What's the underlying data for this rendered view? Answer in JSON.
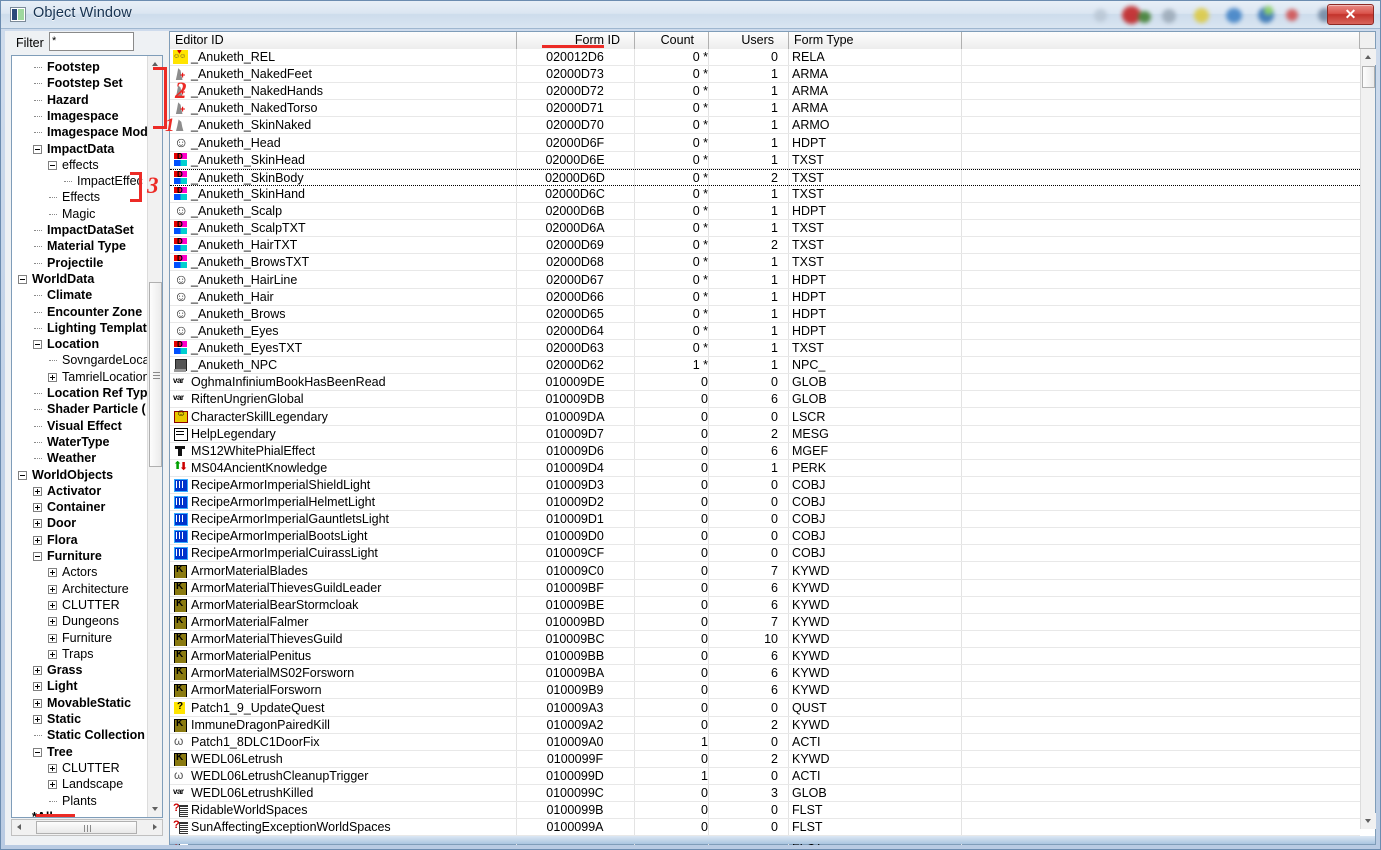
{
  "window": {
    "title": "Object Window",
    "close_label": "✕",
    "icon": "object-window-icon"
  },
  "filter": {
    "label": "Filter",
    "value": "*",
    "placeholder": ""
  },
  "tree": {
    "items": [
      {
        "label": "Footstep",
        "indent": 2,
        "bold": true,
        "toggle": "none"
      },
      {
        "label": "Footstep Set",
        "indent": 2,
        "bold": true,
        "toggle": "none"
      },
      {
        "label": "Hazard",
        "indent": 2,
        "bold": true,
        "toggle": "none"
      },
      {
        "label": "Imagespace",
        "indent": 2,
        "bold": true,
        "toggle": "none"
      },
      {
        "label": "Imagespace Mod",
        "indent": 2,
        "bold": true,
        "toggle": "none"
      },
      {
        "label": "ImpactData",
        "indent": 2,
        "bold": true,
        "toggle": "minus"
      },
      {
        "label": "effects",
        "indent": 3,
        "bold": false,
        "toggle": "minus"
      },
      {
        "label": "ImpactEffec",
        "indent": 4,
        "bold": false,
        "toggle": "none"
      },
      {
        "label": "Effects",
        "indent": 3,
        "bold": false,
        "toggle": "none"
      },
      {
        "label": "Magic",
        "indent": 3,
        "bold": false,
        "toggle": "none"
      },
      {
        "label": "ImpactDataSet",
        "indent": 2,
        "bold": true,
        "toggle": "none"
      },
      {
        "label": "Material Type",
        "indent": 2,
        "bold": true,
        "toggle": "none"
      },
      {
        "label": "Projectile",
        "indent": 2,
        "bold": true,
        "toggle": "none"
      },
      {
        "label": "WorldData",
        "indent": 1,
        "bold": true,
        "toggle": "minus"
      },
      {
        "label": "Climate",
        "indent": 2,
        "bold": true,
        "toggle": "none"
      },
      {
        "label": "Encounter Zone",
        "indent": 2,
        "bold": true,
        "toggle": "none"
      },
      {
        "label": "Lighting Templat",
        "indent": 2,
        "bold": true,
        "toggle": "none"
      },
      {
        "label": "Location",
        "indent": 2,
        "bold": true,
        "toggle": "minus"
      },
      {
        "label": "SovngardeLoca",
        "indent": 3,
        "bold": false,
        "toggle": "none"
      },
      {
        "label": "TamrielLocation",
        "indent": 3,
        "bold": false,
        "toggle": "plus"
      },
      {
        "label": "Location Ref Typ",
        "indent": 2,
        "bold": true,
        "toggle": "none"
      },
      {
        "label": "Shader Particle (",
        "indent": 2,
        "bold": true,
        "toggle": "none"
      },
      {
        "label": "Visual Effect",
        "indent": 2,
        "bold": true,
        "toggle": "none"
      },
      {
        "label": "WaterType",
        "indent": 2,
        "bold": true,
        "toggle": "none"
      },
      {
        "label": "Weather",
        "indent": 2,
        "bold": true,
        "toggle": "none"
      },
      {
        "label": "WorldObjects",
        "indent": 1,
        "bold": true,
        "toggle": "minus"
      },
      {
        "label": "Activator",
        "indent": 2,
        "bold": true,
        "toggle": "plus"
      },
      {
        "label": "Container",
        "indent": 2,
        "bold": true,
        "toggle": "plus"
      },
      {
        "label": "Door",
        "indent": 2,
        "bold": true,
        "toggle": "plus"
      },
      {
        "label": "Flora",
        "indent": 2,
        "bold": true,
        "toggle": "plus"
      },
      {
        "label": "Furniture",
        "indent": 2,
        "bold": true,
        "toggle": "minus"
      },
      {
        "label": "Actors",
        "indent": 3,
        "bold": false,
        "toggle": "plus"
      },
      {
        "label": "Architecture",
        "indent": 3,
        "bold": false,
        "toggle": "plus"
      },
      {
        "label": "CLUTTER",
        "indent": 3,
        "bold": false,
        "toggle": "plus"
      },
      {
        "label": "Dungeons",
        "indent": 3,
        "bold": false,
        "toggle": "plus"
      },
      {
        "label": "Furniture",
        "indent": 3,
        "bold": false,
        "toggle": "plus"
      },
      {
        "label": "Traps",
        "indent": 3,
        "bold": false,
        "toggle": "plus"
      },
      {
        "label": "Grass",
        "indent": 2,
        "bold": true,
        "toggle": "plus"
      },
      {
        "label": "Light",
        "indent": 2,
        "bold": true,
        "toggle": "plus"
      },
      {
        "label": "MovableStatic",
        "indent": 2,
        "bold": true,
        "toggle": "plus"
      },
      {
        "label": "Static",
        "indent": 2,
        "bold": true,
        "toggle": "plus"
      },
      {
        "label": "Static Collection",
        "indent": 2,
        "bold": true,
        "toggle": "none"
      },
      {
        "label": "Tree",
        "indent": 2,
        "bold": true,
        "toggle": "minus"
      },
      {
        "label": "CLUTTER",
        "indent": 3,
        "bold": false,
        "toggle": "plus"
      },
      {
        "label": "Landscape",
        "indent": 3,
        "bold": false,
        "toggle": "plus"
      },
      {
        "label": "Plants",
        "indent": 3,
        "bold": false,
        "toggle": "none"
      },
      {
        "label": "*All",
        "indent": 1,
        "bold": true,
        "toggle": "none"
      }
    ]
  },
  "list": {
    "columns": [
      "Editor ID",
      "Form ID",
      "Count",
      "Users",
      "Form Type"
    ],
    "rows": [
      {
        "editor_id": "_Anuketh_REL",
        "form_id": "020012D6",
        "count": "0 *",
        "users": "0",
        "form_type": "RELA",
        "icon": "rela"
      },
      {
        "editor_id": "_Anuketh_NakedFeet",
        "form_id": "02000D73",
        "count": "0 *",
        "users": "1",
        "form_type": "ARMA",
        "icon": "arma"
      },
      {
        "editor_id": "_Anuketh_NakedHands",
        "form_id": "02000D72",
        "count": "0 *",
        "users": "1",
        "form_type": "ARMA",
        "icon": "arma"
      },
      {
        "editor_id": "_Anuketh_NakedTorso",
        "form_id": "02000D71",
        "count": "0 *",
        "users": "1",
        "form_type": "ARMA",
        "icon": "arma"
      },
      {
        "editor_id": "_Anuketh_SkinNaked",
        "form_id": "02000D70",
        "count": "0 *",
        "users": "1",
        "form_type": "ARMO",
        "icon": "armo"
      },
      {
        "editor_id": "_Anuketh_Head",
        "form_id": "02000D6F",
        "count": "0 *",
        "users": "1",
        "form_type": "HDPT",
        "icon": "hdpt"
      },
      {
        "editor_id": "_Anuketh_SkinHead",
        "form_id": "02000D6E",
        "count": "0 *",
        "users": "1",
        "form_type": "TXST",
        "icon": "txst"
      },
      {
        "editor_id": "_Anuketh_SkinBody",
        "form_id": "02000D6D",
        "count": "0 *",
        "users": "2",
        "form_type": "TXST",
        "icon": "txst",
        "focused": true
      },
      {
        "editor_id": "_Anuketh_SkinHand",
        "form_id": "02000D6C",
        "count": "0 *",
        "users": "1",
        "form_type": "TXST",
        "icon": "txst"
      },
      {
        "editor_id": "_Anuketh_Scalp",
        "form_id": "02000D6B",
        "count": "0 *",
        "users": "1",
        "form_type": "HDPT",
        "icon": "hdpt"
      },
      {
        "editor_id": "_Anuketh_ScalpTXT",
        "form_id": "02000D6A",
        "count": "0 *",
        "users": "1",
        "form_type": "TXST",
        "icon": "txst"
      },
      {
        "editor_id": "_Anuketh_HairTXT",
        "form_id": "02000D69",
        "count": "0 *",
        "users": "2",
        "form_type": "TXST",
        "icon": "txst"
      },
      {
        "editor_id": "_Anuketh_BrowsTXT",
        "form_id": "02000D68",
        "count": "0 *",
        "users": "1",
        "form_type": "TXST",
        "icon": "txst"
      },
      {
        "editor_id": "_Anuketh_HairLine",
        "form_id": "02000D67",
        "count": "0 *",
        "users": "1",
        "form_type": "HDPT",
        "icon": "hdpt"
      },
      {
        "editor_id": "_Anuketh_Hair",
        "form_id": "02000D66",
        "count": "0 *",
        "users": "1",
        "form_type": "HDPT",
        "icon": "hdpt"
      },
      {
        "editor_id": "_Anuketh_Brows",
        "form_id": "02000D65",
        "count": "0 *",
        "users": "1",
        "form_type": "HDPT",
        "icon": "hdpt"
      },
      {
        "editor_id": "_Anuketh_Eyes",
        "form_id": "02000D64",
        "count": "0 *",
        "users": "1",
        "form_type": "HDPT",
        "icon": "hdpt"
      },
      {
        "editor_id": "_Anuketh_EyesTXT",
        "form_id": "02000D63",
        "count": "0 *",
        "users": "1",
        "form_type": "TXST",
        "icon": "txst"
      },
      {
        "editor_id": "_Anuketh_NPC",
        "form_id": "02000D62",
        "count": "1 *",
        "users": "1",
        "form_type": "NPC_",
        "icon": "npc"
      },
      {
        "editor_id": "OghmaInfiniumBookHasBeenRead",
        "form_id": "010009DE",
        "count": "0",
        "users": "0",
        "form_type": "GLOB",
        "icon": "glob"
      },
      {
        "editor_id": "RiftenUngrienGlobal",
        "form_id": "010009DB",
        "count": "0",
        "users": "6",
        "form_type": "GLOB",
        "icon": "glob"
      },
      {
        "editor_id": "CharacterSkillLegendary",
        "form_id": "010009DA",
        "count": "0",
        "users": "0",
        "form_type": "LSCR",
        "icon": "lscr"
      },
      {
        "editor_id": "HelpLegendary",
        "form_id": "010009D7",
        "count": "0",
        "users": "2",
        "form_type": "MESG",
        "icon": "mesg"
      },
      {
        "editor_id": "MS12WhitePhialEffect",
        "form_id": "010009D6",
        "count": "0",
        "users": "6",
        "form_type": "MGEF",
        "icon": "mgef"
      },
      {
        "editor_id": "MS04AncientKnowledge",
        "form_id": "010009D4",
        "count": "0",
        "users": "1",
        "form_type": "PERK",
        "icon": "perk"
      },
      {
        "editor_id": "RecipeArmorImperialShieldLight",
        "form_id": "010009D3",
        "count": "0",
        "users": "0",
        "form_type": "COBJ",
        "icon": "cobj"
      },
      {
        "editor_id": "RecipeArmorImperialHelmetLight",
        "form_id": "010009D2",
        "count": "0",
        "users": "0",
        "form_type": "COBJ",
        "icon": "cobj"
      },
      {
        "editor_id": "RecipeArmorImperialGauntletsLight",
        "form_id": "010009D1",
        "count": "0",
        "users": "0",
        "form_type": "COBJ",
        "icon": "cobj"
      },
      {
        "editor_id": "RecipeArmorImperialBootsLight",
        "form_id": "010009D0",
        "count": "0",
        "users": "0",
        "form_type": "COBJ",
        "icon": "cobj"
      },
      {
        "editor_id": "RecipeArmorImperialCuirassLight",
        "form_id": "010009CF",
        "count": "0",
        "users": "0",
        "form_type": "COBJ",
        "icon": "cobj"
      },
      {
        "editor_id": "ArmorMaterialBlades",
        "form_id": "010009C0",
        "count": "0",
        "users": "7",
        "form_type": "KYWD",
        "icon": "kywd"
      },
      {
        "editor_id": "ArmorMaterialThievesGuildLeader",
        "form_id": "010009BF",
        "count": "0",
        "users": "6",
        "form_type": "KYWD",
        "icon": "kywd"
      },
      {
        "editor_id": "ArmorMaterialBearStormcloak",
        "form_id": "010009BE",
        "count": "0",
        "users": "6",
        "form_type": "KYWD",
        "icon": "kywd"
      },
      {
        "editor_id": "ArmorMaterialFalmer",
        "form_id": "010009BD",
        "count": "0",
        "users": "7",
        "form_type": "KYWD",
        "icon": "kywd"
      },
      {
        "editor_id": "ArmorMaterialThievesGuild",
        "form_id": "010009BC",
        "count": "0",
        "users": "10",
        "form_type": "KYWD",
        "icon": "kywd"
      },
      {
        "editor_id": "ArmorMaterialPenitus",
        "form_id": "010009BB",
        "count": "0",
        "users": "6",
        "form_type": "KYWD",
        "icon": "kywd"
      },
      {
        "editor_id": "ArmorMaterialMS02Forsworn",
        "form_id": "010009BA",
        "count": "0",
        "users": "6",
        "form_type": "KYWD",
        "icon": "kywd"
      },
      {
        "editor_id": "ArmorMaterialForsworn",
        "form_id": "010009B9",
        "count": "0",
        "users": "6",
        "form_type": "KYWD",
        "icon": "kywd"
      },
      {
        "editor_id": "Patch1_9_UpdateQuest",
        "form_id": "010009A3",
        "count": "0",
        "users": "0",
        "form_type": "QUST",
        "icon": "qust"
      },
      {
        "editor_id": "ImmuneDragonPairedKill",
        "form_id": "010009A2",
        "count": "0",
        "users": "2",
        "form_type": "KYWD",
        "icon": "kywd"
      },
      {
        "editor_id": "Patch1_8DLC1DoorFix",
        "form_id": "010009A0",
        "count": "1",
        "users": "0",
        "form_type": "ACTI",
        "icon": "acti"
      },
      {
        "editor_id": "WEDL06Letrush",
        "form_id": "0100099F",
        "count": "0",
        "users": "2",
        "form_type": "KYWD",
        "icon": "kywd"
      },
      {
        "editor_id": "WEDL06LetrushCleanupTrigger",
        "form_id": "0100099D",
        "count": "1",
        "users": "0",
        "form_type": "ACTI",
        "icon": "acti"
      },
      {
        "editor_id": "WEDL06LetrushKilled",
        "form_id": "0100099C",
        "count": "0",
        "users": "3",
        "form_type": "GLOB",
        "icon": "glob"
      },
      {
        "editor_id": "RidableWorldSpaces",
        "form_id": "0100099B",
        "count": "0",
        "users": "0",
        "form_type": "FLST",
        "icon": "flst"
      },
      {
        "editor_id": "SunAffectingExceptionWorldSpaces",
        "form_id": "0100099A",
        "count": "0",
        "users": "0",
        "form_type": "FLST",
        "icon": "flst"
      },
      {
        "editor_id": "",
        "form_id": "",
        "count": "",
        "users": "",
        "form_type": "FLST",
        "icon": "flst"
      }
    ]
  },
  "annotations": {
    "color": "#ec2b26",
    "marks": [
      {
        "name": "filter-arrow",
        "type": "arrow"
      },
      {
        "name": "formid-underline",
        "type": "underline"
      },
      {
        "name": "bracket-naked",
        "type": "bracket",
        "number": "2"
      },
      {
        "name": "number-one",
        "type": "number",
        "number": "1"
      },
      {
        "name": "bracket-skin",
        "type": "bracket",
        "number": "3"
      },
      {
        "name": "all-underline",
        "type": "underline"
      }
    ]
  }
}
